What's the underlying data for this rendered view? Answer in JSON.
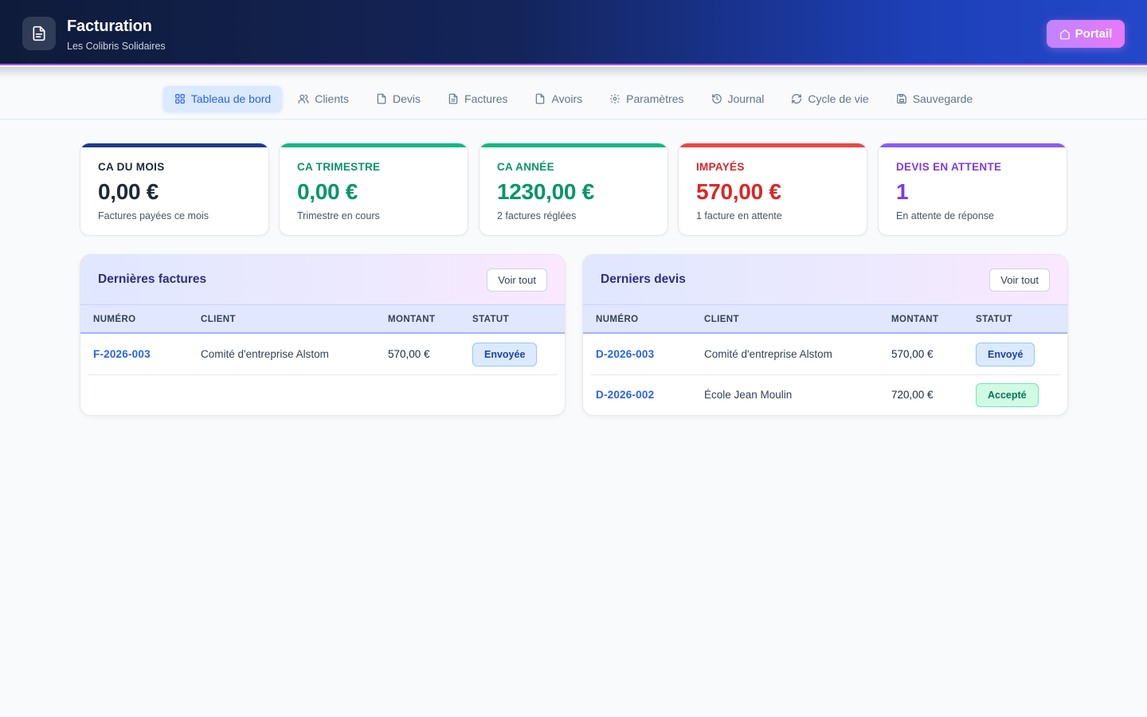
{
  "header": {
    "title": "Facturation",
    "subtitle": "Les Colibris Solidaires",
    "portal_label": "Portail"
  },
  "nav": {
    "tabs": [
      {
        "label": "Tableau de bord",
        "icon": "grid-icon",
        "active": true
      },
      {
        "label": "Clients",
        "icon": "users-icon"
      },
      {
        "label": "Devis",
        "icon": "document-icon"
      },
      {
        "label": "Factures",
        "icon": "invoice-icon"
      },
      {
        "label": "Avoirs",
        "icon": "credit-note-icon"
      },
      {
        "label": "Paramètres",
        "icon": "gear-icon"
      },
      {
        "label": "Journal",
        "icon": "history-icon"
      },
      {
        "label": "Cycle de vie",
        "icon": "refresh-icon"
      },
      {
        "label": "Sauvegarde",
        "icon": "save-icon"
      }
    ]
  },
  "stats": [
    {
      "label": "CA DU MOIS",
      "value": "0,00 €",
      "sub": "Factures payées ce mois",
      "color": "#1e293b",
      "bar": "#1e3a8a"
    },
    {
      "label": "CA TRIMESTRE",
      "value": "0,00 €",
      "sub": "Trimestre en cours",
      "color": "#059669",
      "bar": "#10b981"
    },
    {
      "label": "CA ANNÉE",
      "value": "1230,00 €",
      "sub": "2 factures réglées",
      "color": "#059669",
      "bar": "#10b981"
    },
    {
      "label": "IMPAYÉS",
      "value": "570,00 €",
      "sub": "1 facture en attente",
      "color": "#dc2626",
      "bar": "#ef4444"
    },
    {
      "label": "DEVIS EN ATTENTE",
      "value": "1",
      "sub": "En attente de réponse",
      "color": "#7c3aed",
      "bar": "#8b5cf6"
    }
  ],
  "invoices": {
    "title": "Dernières factures",
    "see_all": "Voir tout",
    "columns": [
      "NUMÉRO",
      "CLIENT",
      "MONTANT",
      "STATUT"
    ],
    "rows": [
      {
        "number": "F-2026-003",
        "client": "Comité d'entreprise Alstom",
        "amount": "570,00 €",
        "status": "Envoyée",
        "status_color": "blue"
      }
    ]
  },
  "quotes": {
    "title": "Derniers devis",
    "see_all": "Voir tout",
    "columns": [
      "NUMÉRO",
      "CLIENT",
      "MONTANT",
      "STATUT"
    ],
    "rows": [
      {
        "number": "D-2026-003",
        "client": "Comité d'entreprise Alstom",
        "amount": "570,00 €",
        "status": "Envoyé",
        "status_color": "blue"
      },
      {
        "number": "D-2026-002",
        "client": "École Jean Moulin",
        "amount": "720,00 €",
        "status": "Accepté",
        "status_color": "green"
      }
    ]
  }
}
